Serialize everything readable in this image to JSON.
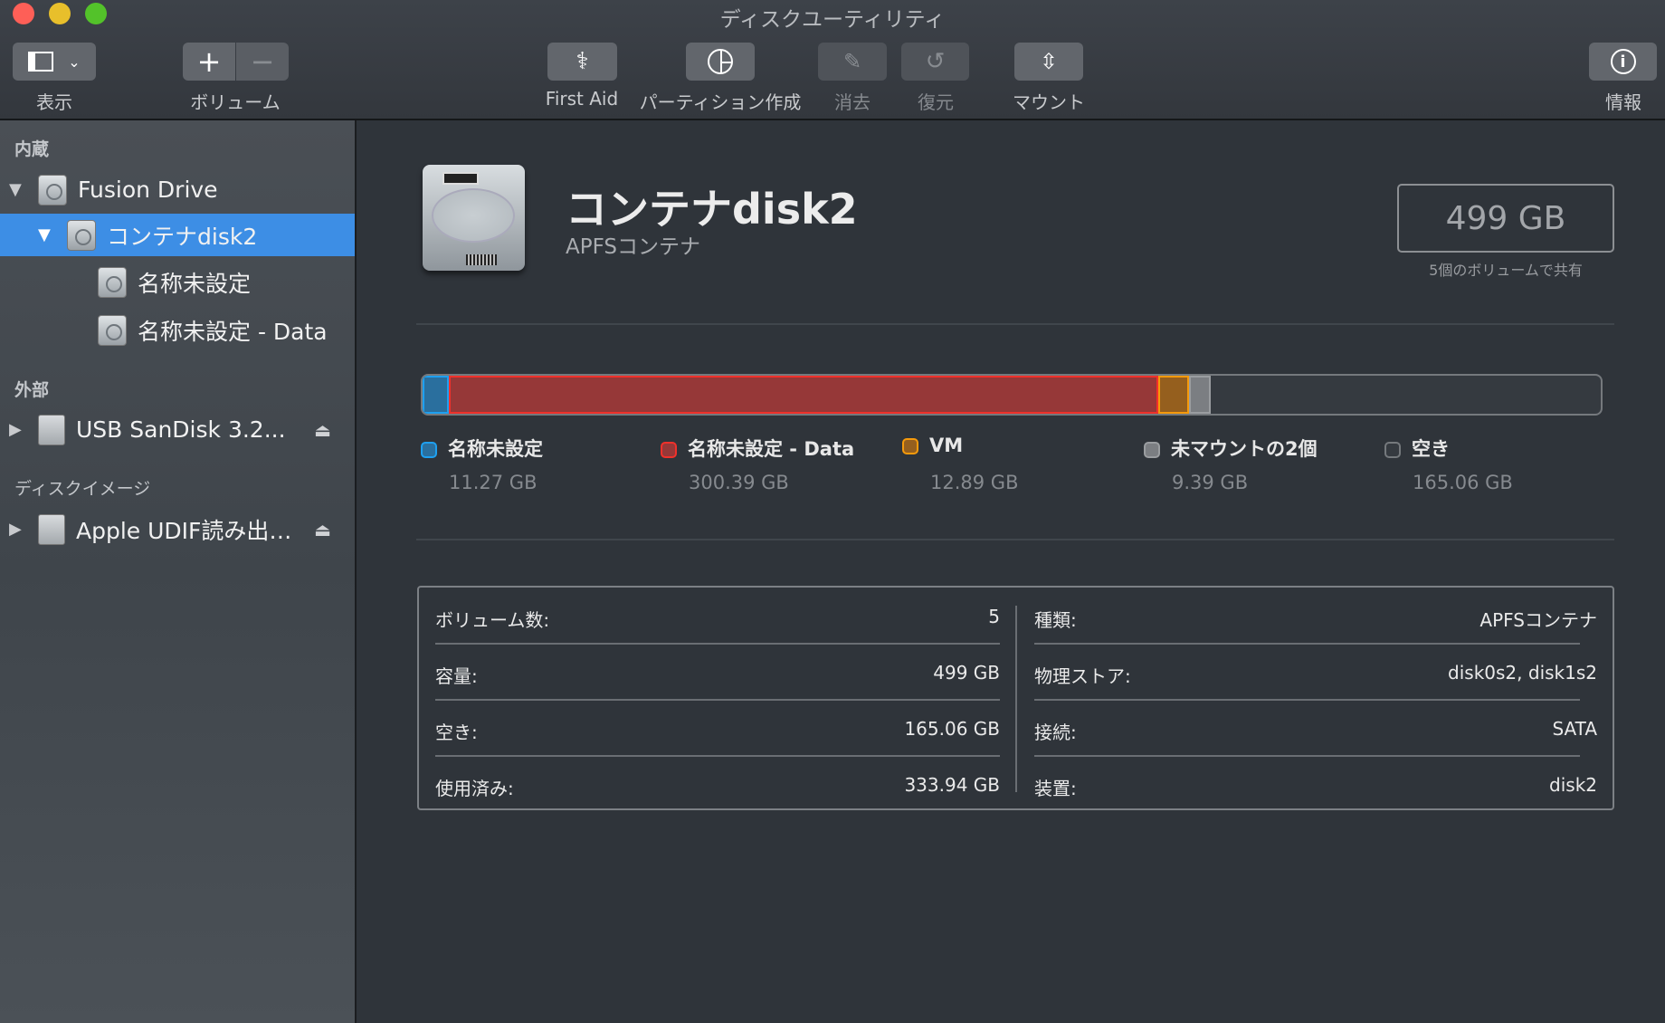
{
  "window": {
    "title": "ディスクユーティリティ"
  },
  "toolbar": {
    "view": "表示",
    "volume": "ボリューム",
    "first_aid": "First Aid",
    "partition": "パーティション作成",
    "erase": "消去",
    "restore": "復元",
    "mount": "マウント",
    "info": "情報"
  },
  "sidebar": {
    "internal": "内蔵",
    "fusion": "Fusion Drive",
    "container": "コンテナdisk2",
    "vol1": "名称未設定",
    "vol2": "名称未設定 - Data",
    "external": "外部",
    "usb": "USB SanDisk 3.2...",
    "images": "ディスクイメージ",
    "udif": "Apple UDIF読み出…"
  },
  "main": {
    "title": "コンテナdisk2",
    "subtitle": "APFSコンテナ",
    "capacity": "499 GB",
    "shared": "5個のボリュームで共有"
  },
  "usage": {
    "total_gb": 499,
    "segments": [
      {
        "name": "名称未設定",
        "value": "11.27 GB",
        "gb": 11.27,
        "color": "#2a6f9e",
        "border": "#1ea0f0"
      },
      {
        "name": "名称未設定 - Data",
        "value": "300.39 GB",
        "gb": 300.39,
        "color": "#963838",
        "border": "#f0312b"
      },
      {
        "name": "VM",
        "value": "12.89 GB",
        "gb": 12.89,
        "color": "#955f1e",
        "border": "#f59a0c"
      },
      {
        "name": "未マウントの2個",
        "value": "9.39 GB",
        "gb": 9.39,
        "color": "#7b7e82",
        "border": "#9a9da0"
      },
      {
        "name": "空き",
        "value": "165.06 GB",
        "gb": 165.06,
        "color": "#353a40",
        "border": "#75797d"
      }
    ]
  },
  "info": {
    "left": [
      {
        "k": "ボリューム数:",
        "v": "5"
      },
      {
        "k": "容量:",
        "v": "499 GB"
      },
      {
        "k": "空き:",
        "v": "165.06 GB"
      },
      {
        "k": "使用済み:",
        "v": "333.94 GB"
      }
    ],
    "right": [
      {
        "k": "種類:",
        "v": "APFSコンテナ"
      },
      {
        "k": "物理ストア:",
        "v": "disk0s2, disk1s2"
      },
      {
        "k": "接続:",
        "v": "SATA"
      },
      {
        "k": "装置:",
        "v": "disk2"
      }
    ]
  }
}
